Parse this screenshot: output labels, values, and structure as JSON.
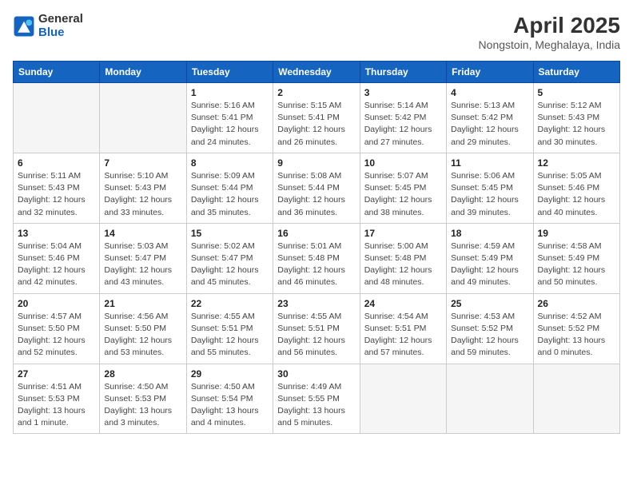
{
  "header": {
    "logo_general": "General",
    "logo_blue": "Blue",
    "month_year": "April 2025",
    "location": "Nongstoin, Meghalaya, India"
  },
  "weekdays": [
    "Sunday",
    "Monday",
    "Tuesday",
    "Wednesday",
    "Thursday",
    "Friday",
    "Saturday"
  ],
  "weeks": [
    [
      {
        "day": "",
        "info": ""
      },
      {
        "day": "",
        "info": ""
      },
      {
        "day": "1",
        "info": "Sunrise: 5:16 AM\nSunset: 5:41 PM\nDaylight: 12 hours\nand 24 minutes."
      },
      {
        "day": "2",
        "info": "Sunrise: 5:15 AM\nSunset: 5:41 PM\nDaylight: 12 hours\nand 26 minutes."
      },
      {
        "day": "3",
        "info": "Sunrise: 5:14 AM\nSunset: 5:42 PM\nDaylight: 12 hours\nand 27 minutes."
      },
      {
        "day": "4",
        "info": "Sunrise: 5:13 AM\nSunset: 5:42 PM\nDaylight: 12 hours\nand 29 minutes."
      },
      {
        "day": "5",
        "info": "Sunrise: 5:12 AM\nSunset: 5:43 PM\nDaylight: 12 hours\nand 30 minutes."
      }
    ],
    [
      {
        "day": "6",
        "info": "Sunrise: 5:11 AM\nSunset: 5:43 PM\nDaylight: 12 hours\nand 32 minutes."
      },
      {
        "day": "7",
        "info": "Sunrise: 5:10 AM\nSunset: 5:43 PM\nDaylight: 12 hours\nand 33 minutes."
      },
      {
        "day": "8",
        "info": "Sunrise: 5:09 AM\nSunset: 5:44 PM\nDaylight: 12 hours\nand 35 minutes."
      },
      {
        "day": "9",
        "info": "Sunrise: 5:08 AM\nSunset: 5:44 PM\nDaylight: 12 hours\nand 36 minutes."
      },
      {
        "day": "10",
        "info": "Sunrise: 5:07 AM\nSunset: 5:45 PM\nDaylight: 12 hours\nand 38 minutes."
      },
      {
        "day": "11",
        "info": "Sunrise: 5:06 AM\nSunset: 5:45 PM\nDaylight: 12 hours\nand 39 minutes."
      },
      {
        "day": "12",
        "info": "Sunrise: 5:05 AM\nSunset: 5:46 PM\nDaylight: 12 hours\nand 40 minutes."
      }
    ],
    [
      {
        "day": "13",
        "info": "Sunrise: 5:04 AM\nSunset: 5:46 PM\nDaylight: 12 hours\nand 42 minutes."
      },
      {
        "day": "14",
        "info": "Sunrise: 5:03 AM\nSunset: 5:47 PM\nDaylight: 12 hours\nand 43 minutes."
      },
      {
        "day": "15",
        "info": "Sunrise: 5:02 AM\nSunset: 5:47 PM\nDaylight: 12 hours\nand 45 minutes."
      },
      {
        "day": "16",
        "info": "Sunrise: 5:01 AM\nSunset: 5:48 PM\nDaylight: 12 hours\nand 46 minutes."
      },
      {
        "day": "17",
        "info": "Sunrise: 5:00 AM\nSunset: 5:48 PM\nDaylight: 12 hours\nand 48 minutes."
      },
      {
        "day": "18",
        "info": "Sunrise: 4:59 AM\nSunset: 5:49 PM\nDaylight: 12 hours\nand 49 minutes."
      },
      {
        "day": "19",
        "info": "Sunrise: 4:58 AM\nSunset: 5:49 PM\nDaylight: 12 hours\nand 50 minutes."
      }
    ],
    [
      {
        "day": "20",
        "info": "Sunrise: 4:57 AM\nSunset: 5:50 PM\nDaylight: 12 hours\nand 52 minutes."
      },
      {
        "day": "21",
        "info": "Sunrise: 4:56 AM\nSunset: 5:50 PM\nDaylight: 12 hours\nand 53 minutes."
      },
      {
        "day": "22",
        "info": "Sunrise: 4:55 AM\nSunset: 5:51 PM\nDaylight: 12 hours\nand 55 minutes."
      },
      {
        "day": "23",
        "info": "Sunrise: 4:55 AM\nSunset: 5:51 PM\nDaylight: 12 hours\nand 56 minutes."
      },
      {
        "day": "24",
        "info": "Sunrise: 4:54 AM\nSunset: 5:51 PM\nDaylight: 12 hours\nand 57 minutes."
      },
      {
        "day": "25",
        "info": "Sunrise: 4:53 AM\nSunset: 5:52 PM\nDaylight: 12 hours\nand 59 minutes."
      },
      {
        "day": "26",
        "info": "Sunrise: 4:52 AM\nSunset: 5:52 PM\nDaylight: 13 hours\nand 0 minutes."
      }
    ],
    [
      {
        "day": "27",
        "info": "Sunrise: 4:51 AM\nSunset: 5:53 PM\nDaylight: 13 hours\nand 1 minute."
      },
      {
        "day": "28",
        "info": "Sunrise: 4:50 AM\nSunset: 5:53 PM\nDaylight: 13 hours\nand 3 minutes."
      },
      {
        "day": "29",
        "info": "Sunrise: 4:50 AM\nSunset: 5:54 PM\nDaylight: 13 hours\nand 4 minutes."
      },
      {
        "day": "30",
        "info": "Sunrise: 4:49 AM\nSunset: 5:55 PM\nDaylight: 13 hours\nand 5 minutes."
      },
      {
        "day": "",
        "info": ""
      },
      {
        "day": "",
        "info": ""
      },
      {
        "day": "",
        "info": ""
      }
    ]
  ]
}
